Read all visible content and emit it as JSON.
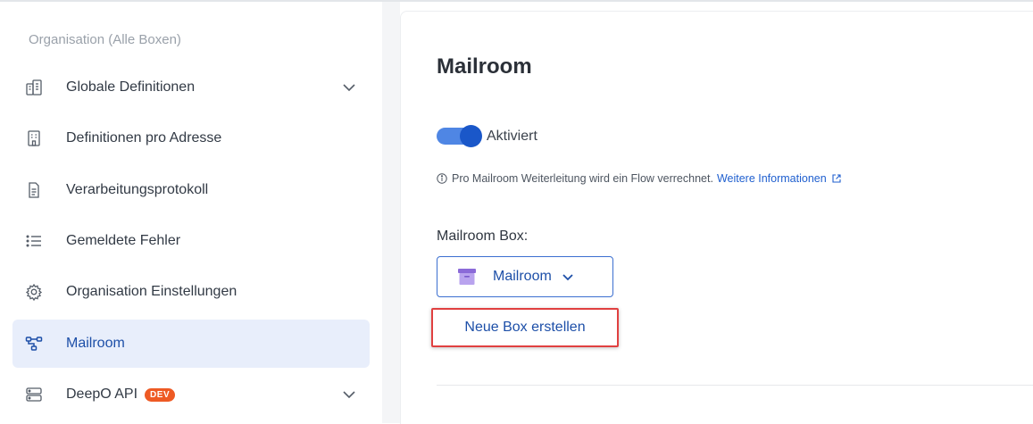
{
  "sidebar": {
    "section_title": "Organisation (Alle Boxen)",
    "items": [
      {
        "label": "Globale Definitionen",
        "icon": "buildings-icon",
        "expandable": true
      },
      {
        "label": "Definitionen pro Adresse",
        "icon": "building-icon"
      },
      {
        "label": "Verarbeitungsprotokoll",
        "icon": "document-icon"
      },
      {
        "label": "Gemeldete Fehler",
        "icon": "list-icon"
      },
      {
        "label": "Organisation Einstellungen",
        "icon": "gear-icon"
      },
      {
        "label": "Mailroom",
        "icon": "flow-icon",
        "active": true
      },
      {
        "label": "DeepO API",
        "icon": "server-icon",
        "badge": "DEV",
        "expandable": true
      }
    ]
  },
  "main": {
    "title": "Mailroom",
    "toggle": {
      "label": "Aktiviert",
      "on": true
    },
    "info": {
      "text": "Pro Mailroom Weiterleitung wird ein Flow verrechnet.",
      "link": "Weitere Informationen"
    },
    "box_field": {
      "label": "Mailroom Box:",
      "selected": "Mailroom"
    },
    "new_box_link": "Neue Box erstellen"
  },
  "colors": {
    "accent": "#1d4fa8",
    "active_bg": "#e8eefb",
    "toggle_track": "#4f86e4",
    "highlight_border": "#e04040",
    "badge": "#ee5a24",
    "box_icon": "#9b7fe0"
  }
}
